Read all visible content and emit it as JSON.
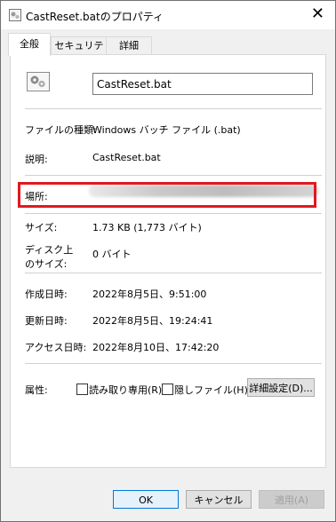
{
  "window": {
    "title": "CastReset.batのプロパティ",
    "close_glyph": "✕"
  },
  "tabs": [
    {
      "label": "全般"
    },
    {
      "label": "セキュリティ"
    },
    {
      "label": "詳細"
    }
  ],
  "general": {
    "file_name": "CastReset.bat",
    "type_label": "ファイルの種類:",
    "type_value": "Windows バッチ ファイル (.bat)",
    "desc_label": "説明:",
    "desc_value": "CastReset.bat",
    "location_label": "場所:",
    "size_label": "サイズ:",
    "size_value": "1.73 KB (1,773 バイト)",
    "disk_label_1": "ディスク上",
    "disk_label_2": "のサイズ:",
    "disk_value": "0 バイト",
    "created_label": "作成日時:",
    "created_value": "2022年8月5日、9:51:00",
    "modified_label": "更新日時:",
    "modified_value": "2022年8月5日、19:24:41",
    "accessed_label": "アクセス日時:",
    "accessed_value": "2022年8月10日、17:42:20",
    "attr_label": "属性:",
    "readonly_label": "読み取り専用(R)",
    "hidden_label": "隠しファイル(H)",
    "advanced_button": "詳細設定(D)..."
  },
  "footer": {
    "ok": "OK",
    "cancel": "キャンセル",
    "apply": "適用(A)"
  },
  "colors": {
    "highlight_box": "#e1191f",
    "primary_border": "#0078d7"
  }
}
